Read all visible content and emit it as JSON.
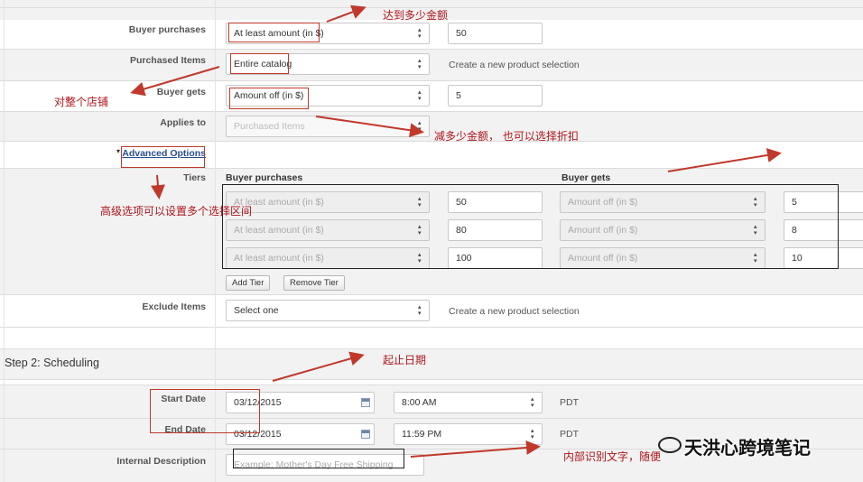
{
  "form": {
    "buyer_purchases": {
      "label": "Buyer purchases",
      "select": "At least amount (in $)",
      "value": "50"
    },
    "purchased_items": {
      "label": "Purchased Items",
      "select": "Entire catalog",
      "link": "Create a new product selection"
    },
    "buyer_gets": {
      "label": "Buyer gets",
      "select": "Amount off (in $)",
      "value": "5"
    },
    "applies_to": {
      "label": "Applies to",
      "select": "Purchased Items"
    },
    "advanced_options": {
      "label": "Advanced Options",
      "toggle": "▾"
    },
    "tiers": {
      "label": "Tiers",
      "col_buyer_purchases": "Buyer purchases",
      "col_buyer_gets": "Buyer gets",
      "rows": [
        {
          "purchase_select": "At least amount (in $)",
          "purchase_value": "50",
          "gets_select": "Amount off (in $)",
          "gets_value": "5"
        },
        {
          "purchase_select": "At least amount (in $)",
          "purchase_value": "80",
          "gets_select": "Amount off (in $)",
          "gets_value": "8"
        },
        {
          "purchase_select": "At least amount (in $)",
          "purchase_value": "100",
          "gets_select": "Amount off (in $)",
          "gets_value": "10"
        }
      ],
      "add_tier": "Add Tier",
      "remove_tier": "Remove Tier"
    },
    "exclude_items": {
      "label": "Exclude Items",
      "select": "Select one",
      "link": "Create a new product selection"
    }
  },
  "scheduling": {
    "title": "Step 2: Scheduling",
    "start_date": {
      "label": "Start Date",
      "date": "03/12/2015",
      "time": "8:00 AM",
      "tz": "PDT"
    },
    "end_date": {
      "label": "End Date",
      "date": "03/12/2015",
      "time": "11:59 PM",
      "tz": "PDT"
    },
    "internal_description": {
      "label": "Internal Description",
      "placeholder": "Example: Mother's Day Free Shipping"
    }
  },
  "annotations": {
    "reach_amount": "达到多少金额",
    "whole_store": "对整个店铺",
    "discount_amount": "减多少金额， 也可以选择折扣",
    "advanced_tiers": "高级选项可以设置多个选择区间",
    "start_end_date": "起止日期",
    "internal_text": "内部识别文字，随便",
    "watermark": "天洪心跨境笔记"
  },
  "colors": {
    "annotation_red": "#c0392b",
    "link_blue": "#2a4d8f",
    "row_gray": "#f2f2f2"
  }
}
